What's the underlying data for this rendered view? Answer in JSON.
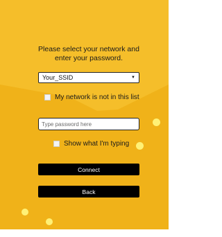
{
  "colors": {
    "background_primary": "#f5be2a",
    "background_secondary": "#f0b219",
    "button_background": "#000000",
    "button_text": "#ffffff",
    "dot_color": "#fff176"
  },
  "instructions": {
    "line1": "Please select your network and",
    "line2": "enter your password."
  },
  "network_select": {
    "selected": "Your_SSID",
    "icon": "dropdown-caret-icon"
  },
  "manual_network": {
    "label": "My network is not in this list",
    "checked": false
  },
  "password": {
    "placeholder": "Type password here",
    "value": ""
  },
  "show_password": {
    "label": "Show what I'm typing",
    "checked": false
  },
  "buttons": {
    "connect": "Connect",
    "back": "Back"
  }
}
